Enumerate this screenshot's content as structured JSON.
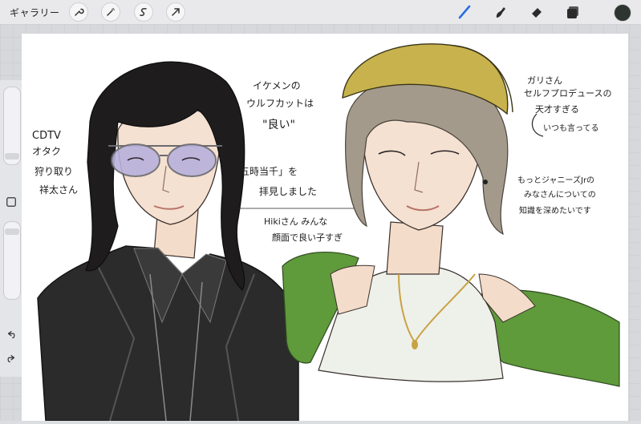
{
  "topbar": {
    "gallery_label": "ギャラリー",
    "tools_left": [
      "wrench-icon",
      "magic-wand-icon",
      "selection-icon",
      "move-arrow-icon"
    ],
    "tools_right": [
      "brush-icon",
      "smudge-icon",
      "eraser-icon",
      "layers-icon"
    ],
    "current_color": "#2e3430"
  },
  "notes": {
    "left_1": "CDTV",
    "left_2": "オタク",
    "left_3": "狩り取り",
    "left_4": "祥太さん",
    "top_1": "イケメンの",
    "top_2": "ウルフカットは",
    "top_3": "\"良い\"",
    "mid_1": "「五時当千」を",
    "mid_2": "拝見しました",
    "bottom_1": "Hikiさん みんな",
    "bottom_2": "顔面で良い子すぎ",
    "right_1": "ガリさん",
    "right_2": "セルフプロデュースの",
    "right_3": "天才すぎる",
    "right_4": "いつも言ってる",
    "right_5": "もっとジャニーズJrの",
    "right_6": "みなさんについての",
    "right_7": "知識を深めたいです"
  }
}
